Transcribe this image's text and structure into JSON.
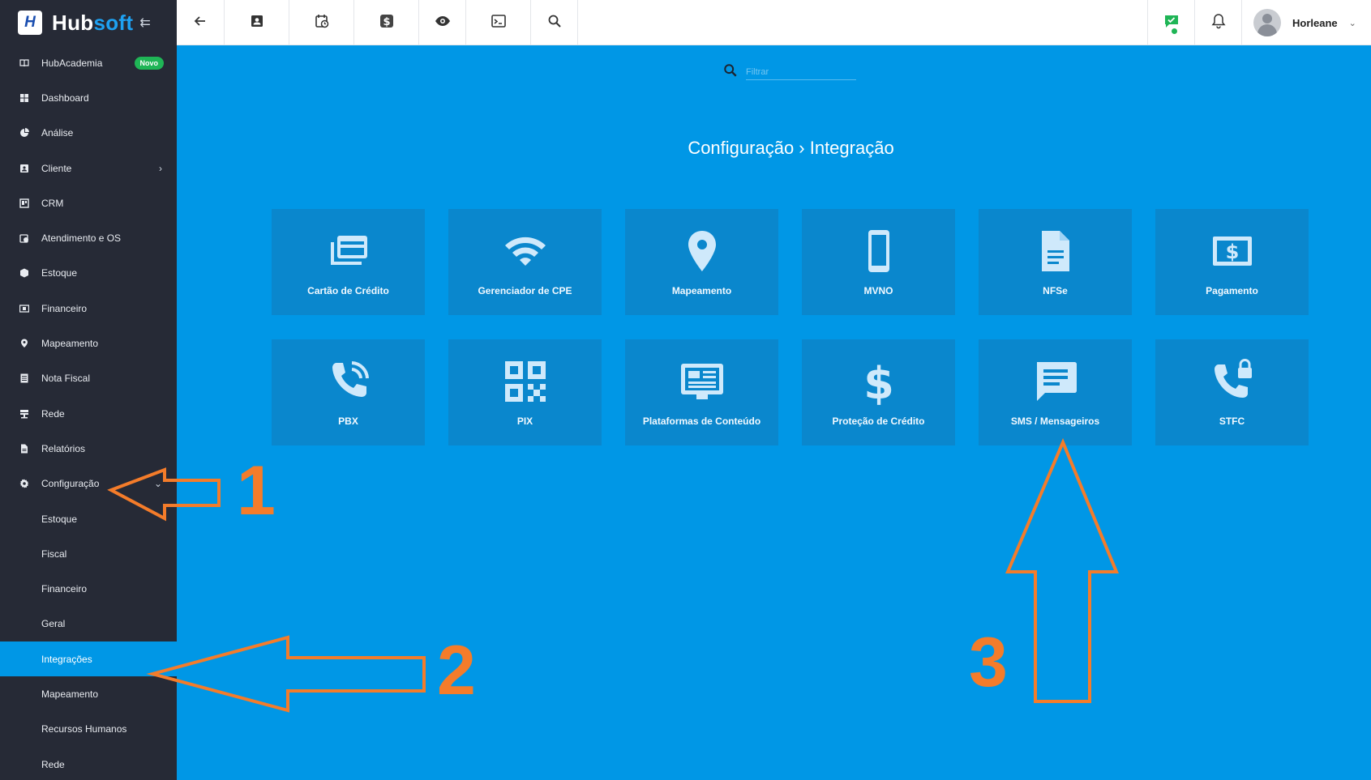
{
  "brand": {
    "name_a": "Hub",
    "name_b": "soft",
    "logo_letter": "H"
  },
  "sidebar": {
    "items": [
      {
        "label": "HubAcademia",
        "icon": "book-icon",
        "badge": "Novo"
      },
      {
        "label": "Dashboard",
        "icon": "dashboard-icon"
      },
      {
        "label": "Análise",
        "icon": "pie-chart-icon"
      },
      {
        "label": "Cliente",
        "icon": "contact-card-icon",
        "chevron": "›"
      },
      {
        "label": "CRM",
        "icon": "crm-icon"
      },
      {
        "label": "Atendimento e OS",
        "icon": "calendar-clock-icon"
      },
      {
        "label": "Estoque",
        "icon": "box-icon"
      },
      {
        "label": "Financeiro",
        "icon": "money-icon"
      },
      {
        "label": "Mapeamento",
        "icon": "map-pin-icon"
      },
      {
        "label": "Nota Fiscal",
        "icon": "document-icon"
      },
      {
        "label": "Rede",
        "icon": "network-icon"
      },
      {
        "label": "Relatórios",
        "icon": "report-icon"
      },
      {
        "label": "Configuração",
        "icon": "gear-icon",
        "chevron": "⌄"
      }
    ],
    "sub_items": [
      "Estoque",
      "Fiscal",
      "Financeiro",
      "Geral",
      "Integrações",
      "Mapeamento",
      "Recursos Humanos",
      "Rede"
    ],
    "active_sub": "Integrações"
  },
  "topbar": {
    "user_name": "Horleane",
    "user_chevron": "⌄"
  },
  "main": {
    "filter_placeholder": "Filtrar",
    "title": "Configuração › Integração",
    "tiles": [
      {
        "label": "Cartão de Crédito",
        "icon": "credit-card-icon"
      },
      {
        "label": "Gerenciador de CPE",
        "icon": "wifi-icon"
      },
      {
        "label": "Mapeamento",
        "icon": "map-pin-icon"
      },
      {
        "label": "MVNO",
        "icon": "smartphone-icon"
      },
      {
        "label": "NFSe",
        "icon": "document-icon"
      },
      {
        "label": "Pagamento",
        "icon": "payment-icon"
      },
      {
        "label": "PBX",
        "icon": "phone-ring-icon"
      },
      {
        "label": "PIX",
        "icon": "qr-code-icon"
      },
      {
        "label": "Plataformas de Conteúdo",
        "icon": "monitor-content-icon"
      },
      {
        "label": "Proteção de Crédito",
        "icon": "dollar-icon"
      },
      {
        "label": "SMS / Mensageiros",
        "icon": "message-icon"
      },
      {
        "label": "STFC",
        "icon": "phone-lock-icon"
      }
    ]
  },
  "annotations": {
    "n1": "1",
    "n2": "2",
    "n3": "3",
    "color": "#f47c2a"
  },
  "colors": {
    "sidebar": "#262a36",
    "main": "#0097e6",
    "tile": "#0a87cd",
    "accent_green": "#1fb556"
  }
}
